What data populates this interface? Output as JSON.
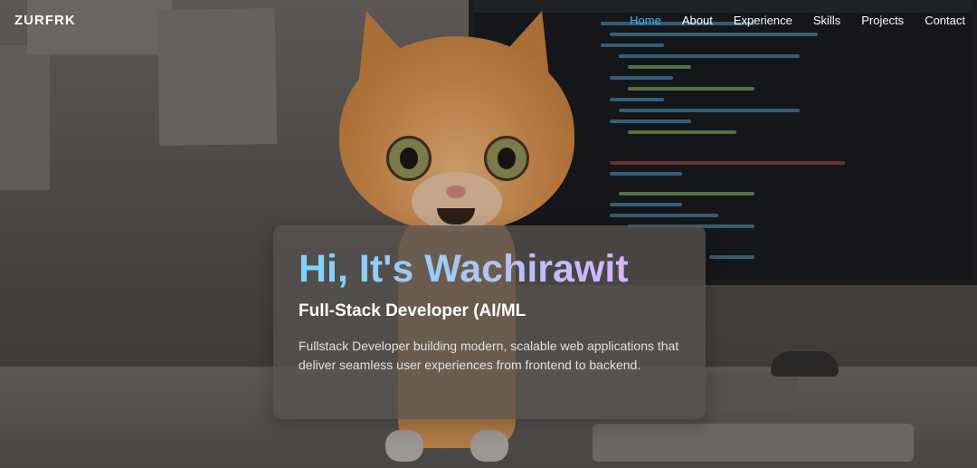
{
  "brand": {
    "logo": "ZURFRK"
  },
  "nav": {
    "items": [
      {
        "label": "Home",
        "active": true
      },
      {
        "label": "About",
        "active": false
      },
      {
        "label": "Experience",
        "active": false
      },
      {
        "label": "Skills",
        "active": false
      },
      {
        "label": "Projects",
        "active": false
      },
      {
        "label": "Contact",
        "active": false
      }
    ]
  },
  "hero": {
    "title": "Hi, It's Wachirawit",
    "subtitle": "Full-Stack Developer (AI/ML",
    "description": "Fullstack Developer building modern, scalable web applications that deliver seamless user experiences from frontend to backend."
  },
  "background": {
    "description_icon": "cat-illustration",
    "monitor_icon": "code-monitor-icon"
  },
  "colors": {
    "nav_active": "#38bdf8",
    "title_gradient_start": "#7dd3fc",
    "title_gradient_end": "#d8b4fe"
  }
}
